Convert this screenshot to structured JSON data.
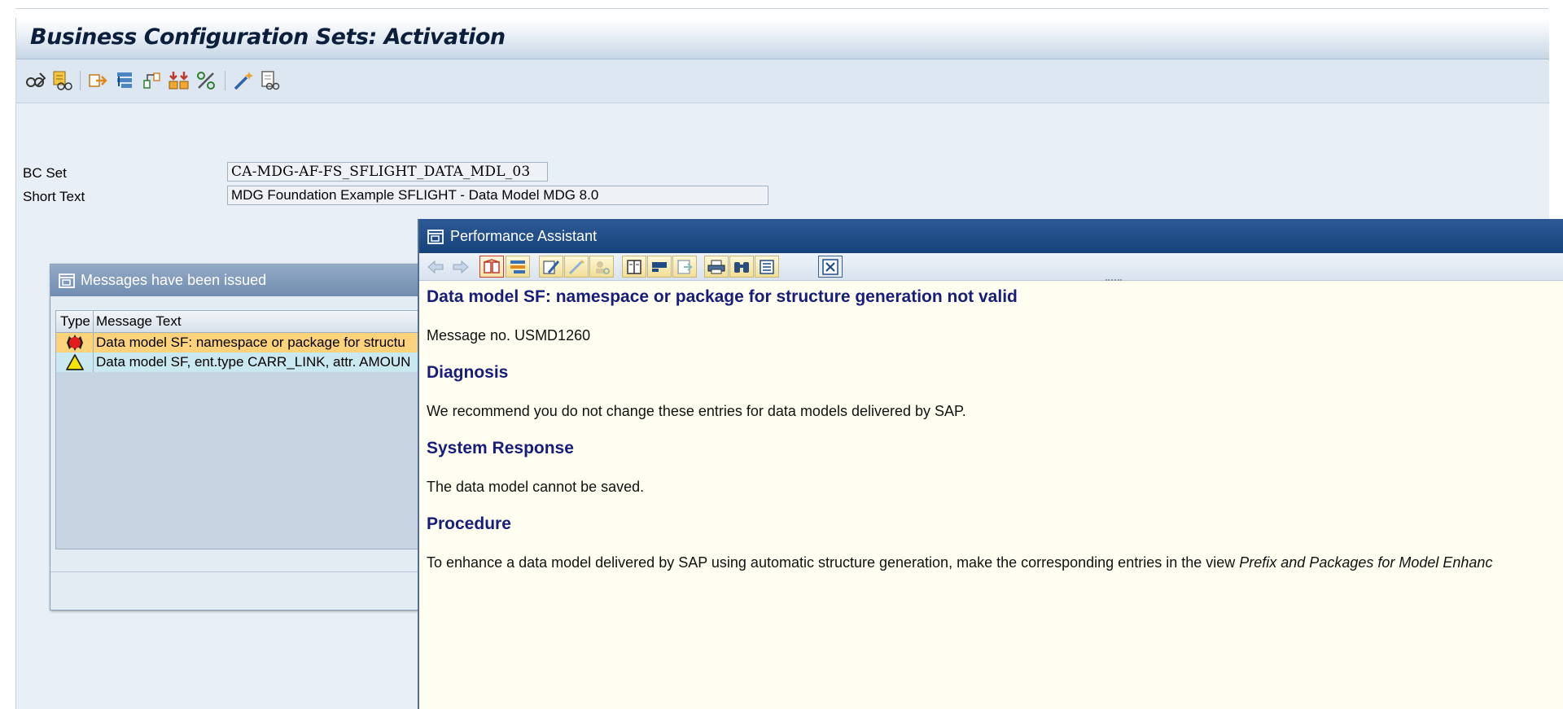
{
  "window": {
    "title": "Business Configuration Sets: Activation"
  },
  "toolbar": {
    "icons": [
      "display-change-icon",
      "transport-icon",
      "export-icon",
      "hierarchy-icon",
      "compare-icon",
      "activate-icon",
      "utilities-icon",
      "magic-wand-icon",
      "display-log-icon"
    ]
  },
  "form": {
    "bc_set_label": "BC Set",
    "bc_set_value": "CA-MDG-AF-FS_SFLIGHT_DATA_MDL_03",
    "short_text_label": "Short Text",
    "short_text_value": "MDG Foundation Example SFLIGHT - Data Model MDG 8.0"
  },
  "messages_dialog": {
    "title": "Messages have been issued",
    "columns": [
      "Type",
      "Message Text"
    ],
    "rows": [
      {
        "type": "error",
        "text": "Data model SF: namespace or package for structu"
      },
      {
        "type": "warning",
        "text": "Data model SF, ent.type CARR_LINK, attr. AMOUN"
      }
    ]
  },
  "performance_assistant": {
    "title": "Performance Assistant",
    "heading": "Data model SF: namespace or package for structure generation not valid",
    "message_no": "Message no. USMD1260",
    "sections": [
      {
        "title": "Diagnosis",
        "text": "We recommend you do not change these entries for data models delivered by SAP."
      },
      {
        "title": "System Response",
        "text": "The data model cannot be saved."
      },
      {
        "title": "Procedure",
        "text": "To enhance a data model delivered by SAP using automatic structure generation, make the corresponding entries in the view ",
        "text_italic": "Prefix and Packages for Model Enhanc"
      }
    ]
  },
  "colors": {
    "pa_title_bg": "#1f4b86",
    "pa_heading": "#161d7a",
    "error_row_bg": "#fcd27a",
    "warning_row_bg": "#c9e8ef",
    "error_icon": "#e21b1b",
    "warning_icon": "#f5e500"
  }
}
